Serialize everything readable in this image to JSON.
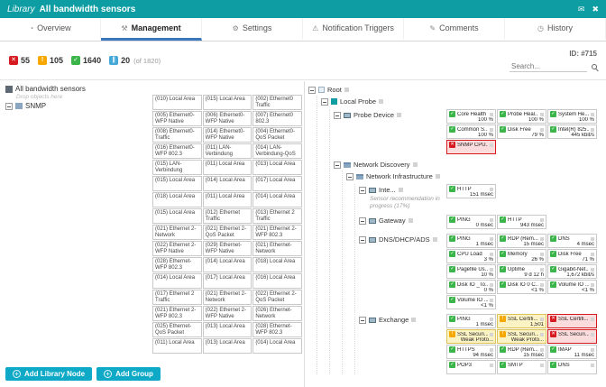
{
  "theme": {
    "header-bg": "#0d9da3",
    "accent-blue": "#3a77bd",
    "btn-cyan": "#0da9c6",
    "up": "#3bb54a",
    "warning": "#f7a800",
    "down": "#d71920",
    "paused": "#44a8d8"
  },
  "icons": {
    "up": "✓",
    "warning": "!",
    "down": "✕",
    "paused": "∥",
    "plus": "+",
    "gauge": "◔",
    "wrench": "⚒",
    "gear": "⚙",
    "bell": "⚠",
    "comment": "✎",
    "clock": "◷",
    "mail": "✉",
    "close": "✖"
  },
  "header": {
    "app": "Library",
    "title": "All bandwidth sensors"
  },
  "tabs": [
    {
      "label": "Overview",
      "icon": "gauge",
      "state": ""
    },
    {
      "label": "Management",
      "icon": "wrench",
      "state": "active"
    },
    {
      "label": "Settings",
      "icon": "gear",
      "state": ""
    },
    {
      "label": "Notification Triggers",
      "icon": "bell",
      "state": ""
    },
    {
      "label": "Comments",
      "icon": "comment",
      "state": ""
    },
    {
      "label": "History",
      "icon": "clock",
      "state": ""
    }
  ],
  "statusbar": {
    "counts": [
      {
        "value": "55",
        "type": "down"
      },
      {
        "value": "105",
        "type": "warning"
      },
      {
        "value": "1640",
        "type": "up"
      },
      {
        "value": "20",
        "type": "paused"
      }
    ],
    "total": "(of 1820)",
    "id": "ID: #715",
    "search_placeholder": "Search..."
  },
  "library": {
    "root": "All bandwidth sensors",
    "drop_hint": "Drop objects here",
    "node": "SNMP",
    "items": [
      "(010) Local Area",
      "(015) Local Area",
      "(002) Ethernet0 Traffic",
      "(005) Ethernet0-WFP Native",
      "(006) Ethernet0-WFP Native",
      "(007) Ethernet0 802.3",
      "(008) Ethernet0-Traffic",
      "(014) Ethernet0-WFP Native",
      "(004) Ethernet0-QoS Packet",
      "(016) Ethernet0-WFP 802.3",
      "(011) LAN-Verbindung",
      "(014) LAN-Verbindung-QoS",
      "(015) LAN-Verbindung",
      "(011) Local Area",
      "(013) Local Area",
      "(015) Local Area",
      "(014) Local Area",
      "(017) Local Area",
      "(018) Local Area",
      "(011) Local Area",
      "(014) Local Area",
      "(015) Local Area",
      "(012) Ethernet Traffic",
      "(013) Ethernet 2 Traffic",
      "(021) Ethernet 2-Network",
      "(021) Ethernet 2-QoS Packet",
      "(021) Ethernet 2-WFP 802.3",
      "(022) Ethernet 2-WFP Native",
      "(029) Ethernet-WFP Native",
      "(021) Ethernet-Network",
      "(028) Ethernet-WFP 802.3",
      "(014) Local Area",
      "(018) Local Area",
      "(014) Local Area",
      "(017) Local Area",
      "(016) Local Area",
      "(017) Ethernet 2 Traffic",
      "(021) Ethernet 2-Network",
      "(022) Ethernet 2-QoS Packet",
      "(021) Ethernet 2-WFP 802.3",
      "(022) Ethernet 2-WFP Native",
      "(026) Ethernet-Network",
      "(025) Ethernet-QoS Packet",
      "(013) Local Area",
      "(028) Ethernet-WFP 802.3",
      "(011) Local Area",
      "(013) Local Area",
      "(014) Local Area"
    ]
  },
  "footer_buttons": [
    {
      "label": "Add Library Node",
      "icon": "plus"
    },
    {
      "label": "Add Group",
      "icon": "plus"
    }
  ],
  "tree": {
    "root": "Root",
    "probe": "Local Probe",
    "probe_device": {
      "label": "Probe Device",
      "sensors": [
        {
          "name": "Core Health",
          "value": "100 %",
          "status": "up"
        },
        {
          "name": "Probe Heal...",
          "value": "100 %",
          "status": "up"
        },
        {
          "name": "System He...",
          "value": "100 %",
          "status": "up"
        },
        {
          "name": "Common S...",
          "value": "100 %",
          "status": "up"
        },
        {
          "name": "Disk Free",
          "value": "79 %",
          "status": "up"
        },
        {
          "name": "Intel(R) 825...",
          "value": "445 kbit/s",
          "status": "up"
        },
        {
          "name": "SNMP CPU...",
          "value": "",
          "status": "down"
        }
      ]
    },
    "network_discovery": "Network Discovery",
    "network_infrastructure": "Network Infrastructure",
    "inte": {
      "label": "Inte...",
      "note": "Sensor recommendation in progress (17%)",
      "sensors": [
        {
          "name": "HTTP",
          "value": "151 msec",
          "status": "up"
        }
      ]
    },
    "gateway": {
      "label": "Gateway",
      "sensors": [
        {
          "name": "PING",
          "value": "0 msec",
          "status": "up"
        },
        {
          "name": "HTTP",
          "value": "943 msec",
          "status": "up"
        }
      ]
    },
    "dns": {
      "label": "DNS/DHCP/ADS",
      "sensors": [
        {
          "name": "PING",
          "value": "1 msec",
          "status": "up"
        },
        {
          "name": "RDP (Rem...",
          "value": "15 msec",
          "status": "up"
        },
        {
          "name": "DNS",
          "value": "4 msec",
          "status": "up"
        },
        {
          "name": "CPU Load",
          "value": "3 %",
          "status": "up"
        },
        {
          "name": "Memory",
          "value": "26 %",
          "status": "up"
        },
        {
          "name": "Disk Free",
          "value": "71 %",
          "status": "up"
        },
        {
          "name": "Pagefile Us...",
          "value": "10 %",
          "status": "up"
        },
        {
          "name": "Uptime",
          "value": "9 d 12 h",
          "status": "up"
        },
        {
          "name": "Gigabit-Net...",
          "value": "1,672 kbit/s",
          "status": "up"
        },
        {
          "name": "Disk IO _To...",
          "value": "0 %",
          "status": "up"
        },
        {
          "name": "Disk IO 0 C...",
          "value": "<1 %",
          "status": "up"
        },
        {
          "name": "Volume IO ...",
          "value": "<1 %",
          "status": "up"
        },
        {
          "name": "Volume IO ...",
          "value": "<1 %",
          "status": "up"
        }
      ]
    },
    "exchange": {
      "label": "Exchange",
      "sensors": [
        {
          "name": "PING",
          "value": "1 msec",
          "status": "up"
        },
        {
          "name": "SSL Certifi...",
          "value": "1,501",
          "status": "warning"
        },
        {
          "name": "SSL Certifi...",
          "value": "",
          "status": "down"
        },
        {
          "name": "SSL Securi...",
          "value": "Weak Proto...",
          "status": "warning"
        },
        {
          "name": "SSL Securi...",
          "value": "Weak Proto...",
          "status": "warning"
        },
        {
          "name": "SSL Securi...",
          "value": "",
          "status": "down"
        },
        {
          "name": "HTTPS",
          "value": "94 msec",
          "status": "up"
        },
        {
          "name": "RDP (Rem...",
          "value": "15 msec",
          "status": "up"
        },
        {
          "name": "IMAP",
          "value": "11 msec",
          "status": "up"
        },
        {
          "name": "POP3",
          "value": "",
          "status": "up"
        },
        {
          "name": "SMTP",
          "value": "",
          "status": "up"
        },
        {
          "name": "DNS",
          "value": "",
          "status": "up"
        }
      ]
    }
  }
}
